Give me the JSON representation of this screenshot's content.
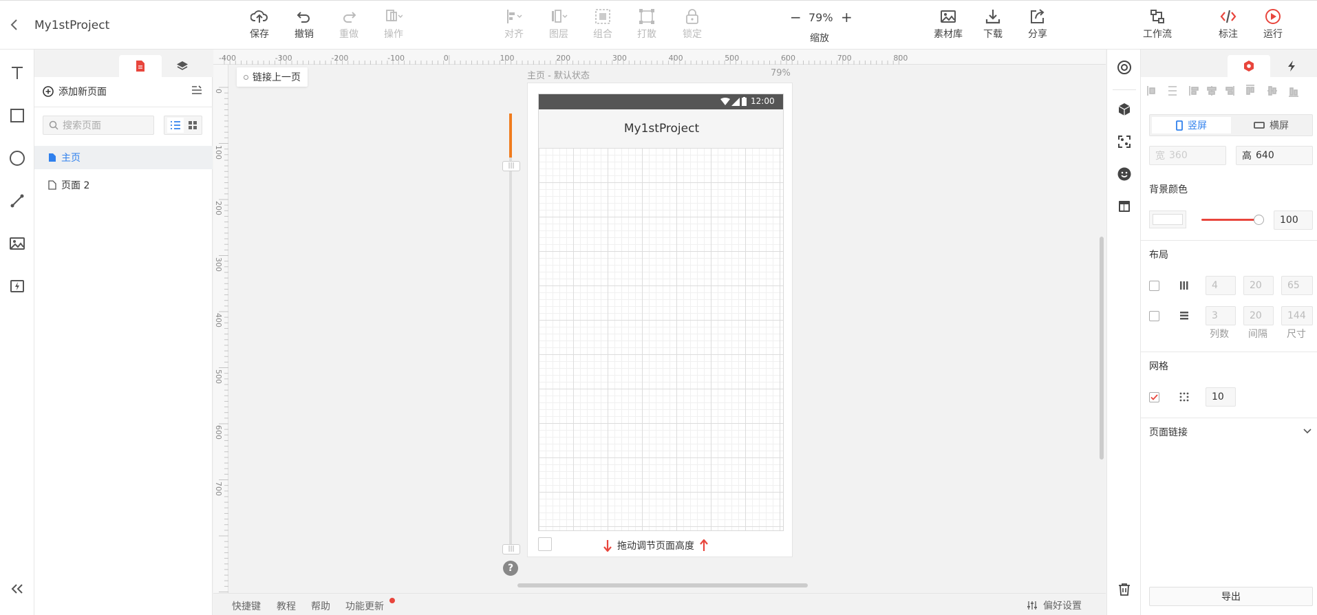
{
  "project": {
    "name": "My1stProject"
  },
  "toolbar": {
    "save": "保存",
    "undo": "撤销",
    "redo": "重做",
    "operate": "操作",
    "align": "对齐",
    "layer": "图层",
    "group": "组合",
    "ungroup": "打散",
    "lock": "锁定",
    "zoom_value": "79%",
    "zoom_label": "缩放",
    "zoom_minus": "−",
    "zoom_plus": "+",
    "assets": "素材库",
    "download": "下载",
    "share": "分享",
    "workflow": "工作流",
    "annotate": "标注",
    "run": "运行"
  },
  "pages": {
    "add_label": "添加新页面",
    "search_placeholder": "搜索页面",
    "items": [
      {
        "label": "主页",
        "active": true
      },
      {
        "label": "页面 2",
        "active": false
      }
    ]
  },
  "canvas": {
    "link_prev": "链接上一页",
    "state_label": "主页 - 默认状态",
    "zoom": "79%",
    "status_time": "12:00",
    "app_title": "My1stProject",
    "drag_hint": "拖动调节页面高度",
    "help": "?",
    "ruler_top": [
      "-400",
      "-300",
      "-200",
      "-100",
      "0",
      "100",
      "200",
      "300",
      "400",
      "500",
      "600",
      "700",
      "800"
    ],
    "ruler_left": [
      "0",
      "100",
      "200",
      "300",
      "400",
      "500",
      "600",
      "700"
    ]
  },
  "props": {
    "portrait": "竖屏",
    "landscape": "横屏",
    "width_label": "宽",
    "width_value": "360",
    "height_label": "高",
    "height_value": "640",
    "bg_color_title": "背景颜色",
    "opacity": "100",
    "layout_title": "布局",
    "cols": {
      "count": "4",
      "gap": "20",
      "size": "65"
    },
    "rows": {
      "count": "3",
      "gap": "20",
      "size": "144"
    },
    "col_count_label": "列数",
    "gap_label": "间隔",
    "size_label": "尺寸",
    "grid_title": "网格",
    "grid_value": "10",
    "page_link_title": "页面链接",
    "export": "导出"
  },
  "bottom": {
    "shortcuts": "快捷键",
    "tutorial": "教程",
    "help": "帮助",
    "updates": "功能更新",
    "prefs": "偏好设置"
  },
  "colors": {
    "accent_blue": "#2f80ed",
    "accent_red": "#e8453c",
    "orange": "#f07c1e"
  }
}
